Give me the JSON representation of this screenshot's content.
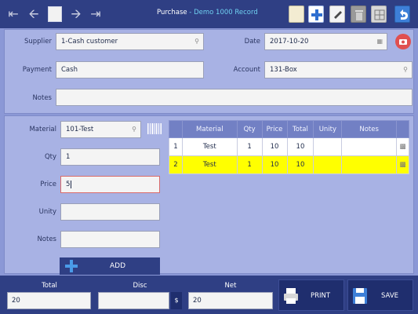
{
  "header": {
    "title": "Purchase",
    "subtitle": " - Demo 1000 Record",
    "nav_icons": [
      "first-arrow-icon",
      "prev-arrow-icon",
      "home-icon",
      "next-arrow-icon",
      "last-arrow-icon"
    ],
    "toolbar_icons": [
      "new-document-icon",
      "add-icon",
      "edit-icon",
      "delete-icon",
      "list-icon",
      "undo-icon"
    ]
  },
  "form": {
    "supplier_label": "Supplier",
    "supplier_value": "1-Cash customer",
    "date_label": "Date",
    "date_value": "2017-10-20",
    "payment_label": "Payment",
    "payment_value": "Cash",
    "account_label": "Account",
    "account_value": "131-Box",
    "notes_label": "Notes",
    "notes_value": ""
  },
  "line_form": {
    "material_label": "Material",
    "material_value": "101-Test",
    "qty_label": "Qty",
    "qty_value": "1",
    "price_label": "Price",
    "price_value": "5",
    "unity_label": "Unity",
    "unity_value": "",
    "notes_label": "Notes",
    "notes_value": "",
    "add_label": "ADD"
  },
  "table": {
    "columns": [
      "",
      "Material",
      "Qty",
      "Price",
      "Total",
      "Unity",
      "Notes"
    ],
    "rows": [
      {
        "no": "1",
        "material": "Test",
        "qty": "1",
        "price": "10",
        "total": "10",
        "unity": "",
        "notes": ""
      },
      {
        "no": "2",
        "material": "Test",
        "qty": "1",
        "price": "10",
        "total": "10",
        "unity": "",
        "notes": ""
      }
    ],
    "selected_row_color": "#ffff00"
  },
  "footer": {
    "total_label": "Total",
    "total_value": "20",
    "disc_label": "Disc",
    "disc_value": "",
    "disc_unit": "$",
    "net_label": "Net",
    "net_value": "20",
    "print_label": "PRINT",
    "save_label": "SAVE"
  },
  "colors": {
    "header_bg": "#2f3f84",
    "panel_bg": "#a8b2e4",
    "accent_cyan": "#6fd0f0",
    "camera_red": "#e05050"
  }
}
